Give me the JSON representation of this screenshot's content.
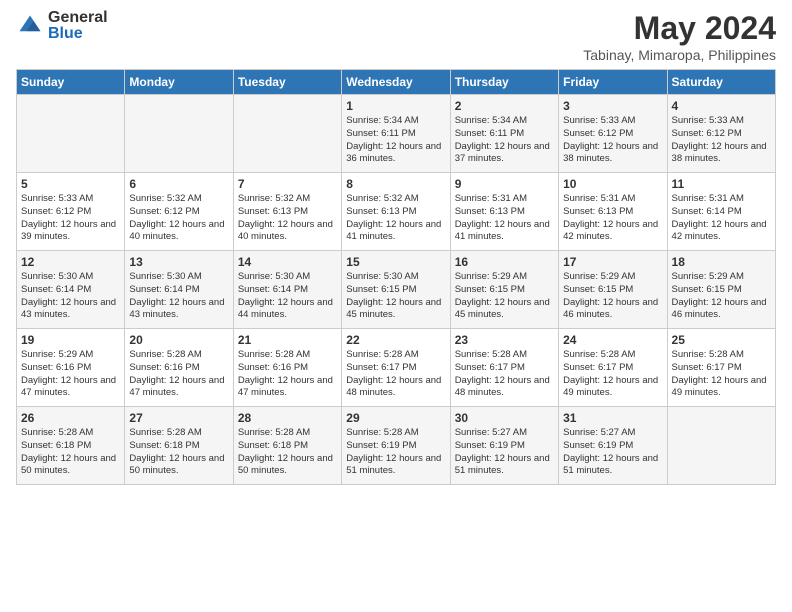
{
  "logo": {
    "general": "General",
    "blue": "Blue"
  },
  "title": "May 2024",
  "subtitle": "Tabinay, Mimaropa, Philippines",
  "days_of_week": [
    "Sunday",
    "Monday",
    "Tuesday",
    "Wednesday",
    "Thursday",
    "Friday",
    "Saturday"
  ],
  "weeks": [
    [
      {
        "day": "",
        "info": ""
      },
      {
        "day": "",
        "info": ""
      },
      {
        "day": "",
        "info": ""
      },
      {
        "day": "1",
        "info": "Sunrise: 5:34 AM\nSunset: 6:11 PM\nDaylight: 12 hours and 36 minutes."
      },
      {
        "day": "2",
        "info": "Sunrise: 5:34 AM\nSunset: 6:11 PM\nDaylight: 12 hours and 37 minutes."
      },
      {
        "day": "3",
        "info": "Sunrise: 5:33 AM\nSunset: 6:12 PM\nDaylight: 12 hours and 38 minutes."
      },
      {
        "day": "4",
        "info": "Sunrise: 5:33 AM\nSunset: 6:12 PM\nDaylight: 12 hours and 38 minutes."
      }
    ],
    [
      {
        "day": "5",
        "info": "Sunrise: 5:33 AM\nSunset: 6:12 PM\nDaylight: 12 hours and 39 minutes."
      },
      {
        "day": "6",
        "info": "Sunrise: 5:32 AM\nSunset: 6:12 PM\nDaylight: 12 hours and 40 minutes."
      },
      {
        "day": "7",
        "info": "Sunrise: 5:32 AM\nSunset: 6:13 PM\nDaylight: 12 hours and 40 minutes."
      },
      {
        "day": "8",
        "info": "Sunrise: 5:32 AM\nSunset: 6:13 PM\nDaylight: 12 hours and 41 minutes."
      },
      {
        "day": "9",
        "info": "Sunrise: 5:31 AM\nSunset: 6:13 PM\nDaylight: 12 hours and 41 minutes."
      },
      {
        "day": "10",
        "info": "Sunrise: 5:31 AM\nSunset: 6:13 PM\nDaylight: 12 hours and 42 minutes."
      },
      {
        "day": "11",
        "info": "Sunrise: 5:31 AM\nSunset: 6:14 PM\nDaylight: 12 hours and 42 minutes."
      }
    ],
    [
      {
        "day": "12",
        "info": "Sunrise: 5:30 AM\nSunset: 6:14 PM\nDaylight: 12 hours and 43 minutes."
      },
      {
        "day": "13",
        "info": "Sunrise: 5:30 AM\nSunset: 6:14 PM\nDaylight: 12 hours and 43 minutes."
      },
      {
        "day": "14",
        "info": "Sunrise: 5:30 AM\nSunset: 6:14 PM\nDaylight: 12 hours and 44 minutes."
      },
      {
        "day": "15",
        "info": "Sunrise: 5:30 AM\nSunset: 6:15 PM\nDaylight: 12 hours and 45 minutes."
      },
      {
        "day": "16",
        "info": "Sunrise: 5:29 AM\nSunset: 6:15 PM\nDaylight: 12 hours and 45 minutes."
      },
      {
        "day": "17",
        "info": "Sunrise: 5:29 AM\nSunset: 6:15 PM\nDaylight: 12 hours and 46 minutes."
      },
      {
        "day": "18",
        "info": "Sunrise: 5:29 AM\nSunset: 6:15 PM\nDaylight: 12 hours and 46 minutes."
      }
    ],
    [
      {
        "day": "19",
        "info": "Sunrise: 5:29 AM\nSunset: 6:16 PM\nDaylight: 12 hours and 47 minutes."
      },
      {
        "day": "20",
        "info": "Sunrise: 5:28 AM\nSunset: 6:16 PM\nDaylight: 12 hours and 47 minutes."
      },
      {
        "day": "21",
        "info": "Sunrise: 5:28 AM\nSunset: 6:16 PM\nDaylight: 12 hours and 47 minutes."
      },
      {
        "day": "22",
        "info": "Sunrise: 5:28 AM\nSunset: 6:17 PM\nDaylight: 12 hours and 48 minutes."
      },
      {
        "day": "23",
        "info": "Sunrise: 5:28 AM\nSunset: 6:17 PM\nDaylight: 12 hours and 48 minutes."
      },
      {
        "day": "24",
        "info": "Sunrise: 5:28 AM\nSunset: 6:17 PM\nDaylight: 12 hours and 49 minutes."
      },
      {
        "day": "25",
        "info": "Sunrise: 5:28 AM\nSunset: 6:17 PM\nDaylight: 12 hours and 49 minutes."
      }
    ],
    [
      {
        "day": "26",
        "info": "Sunrise: 5:28 AM\nSunset: 6:18 PM\nDaylight: 12 hours and 50 minutes."
      },
      {
        "day": "27",
        "info": "Sunrise: 5:28 AM\nSunset: 6:18 PM\nDaylight: 12 hours and 50 minutes."
      },
      {
        "day": "28",
        "info": "Sunrise: 5:28 AM\nSunset: 6:18 PM\nDaylight: 12 hours and 50 minutes."
      },
      {
        "day": "29",
        "info": "Sunrise: 5:28 AM\nSunset: 6:19 PM\nDaylight: 12 hours and 51 minutes."
      },
      {
        "day": "30",
        "info": "Sunrise: 5:27 AM\nSunset: 6:19 PM\nDaylight: 12 hours and 51 minutes."
      },
      {
        "day": "31",
        "info": "Sunrise: 5:27 AM\nSunset: 6:19 PM\nDaylight: 12 hours and 51 minutes."
      },
      {
        "day": "",
        "info": ""
      }
    ]
  ]
}
